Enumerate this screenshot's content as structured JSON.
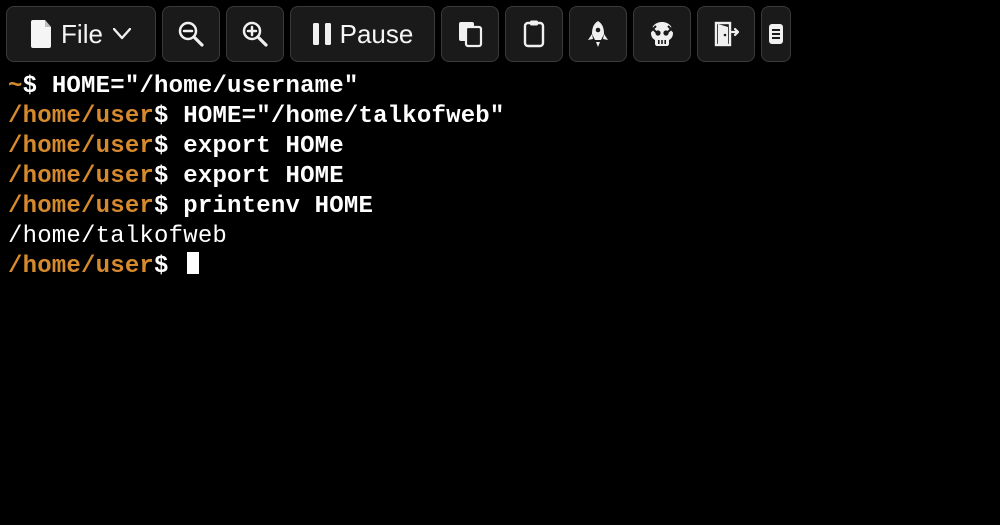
{
  "toolbar": {
    "file_label": "File",
    "pause_label": "Pause",
    "icons": {
      "file": "file-icon",
      "zoom_out": "zoom-out-icon",
      "zoom_in": "zoom-in-icon",
      "pause": "pause-icon",
      "copy": "copy-icon",
      "paste": "clipboard-icon",
      "rocket": "rocket-icon",
      "skull": "skull-icon",
      "exit": "door-exit-icon",
      "more": "more-icon"
    }
  },
  "terminal": {
    "lines": [
      {
        "prompt_path": "~",
        "prompt_sym": "$",
        "command": "HOME=\"/home/username\""
      },
      {
        "prompt_path": "/home/user",
        "prompt_sym": "$",
        "command": "HOME=\"/home/talkofweb\""
      },
      {
        "prompt_path": "/home/user",
        "prompt_sym": "$",
        "command": "export HOMe"
      },
      {
        "prompt_path": "/home/user",
        "prompt_sym": "$",
        "command": "export HOME"
      },
      {
        "prompt_path": "/home/user",
        "prompt_sym": "$",
        "command": "printenv HOME"
      },
      {
        "output": "/home/talkofweb"
      },
      {
        "prompt_path": "/home/user",
        "prompt_sym": "$",
        "command": "",
        "cursor": true
      }
    ]
  },
  "colors": {
    "prompt_path": "#d68a2e",
    "bg": "#000000",
    "fg": "#ffffff"
  }
}
